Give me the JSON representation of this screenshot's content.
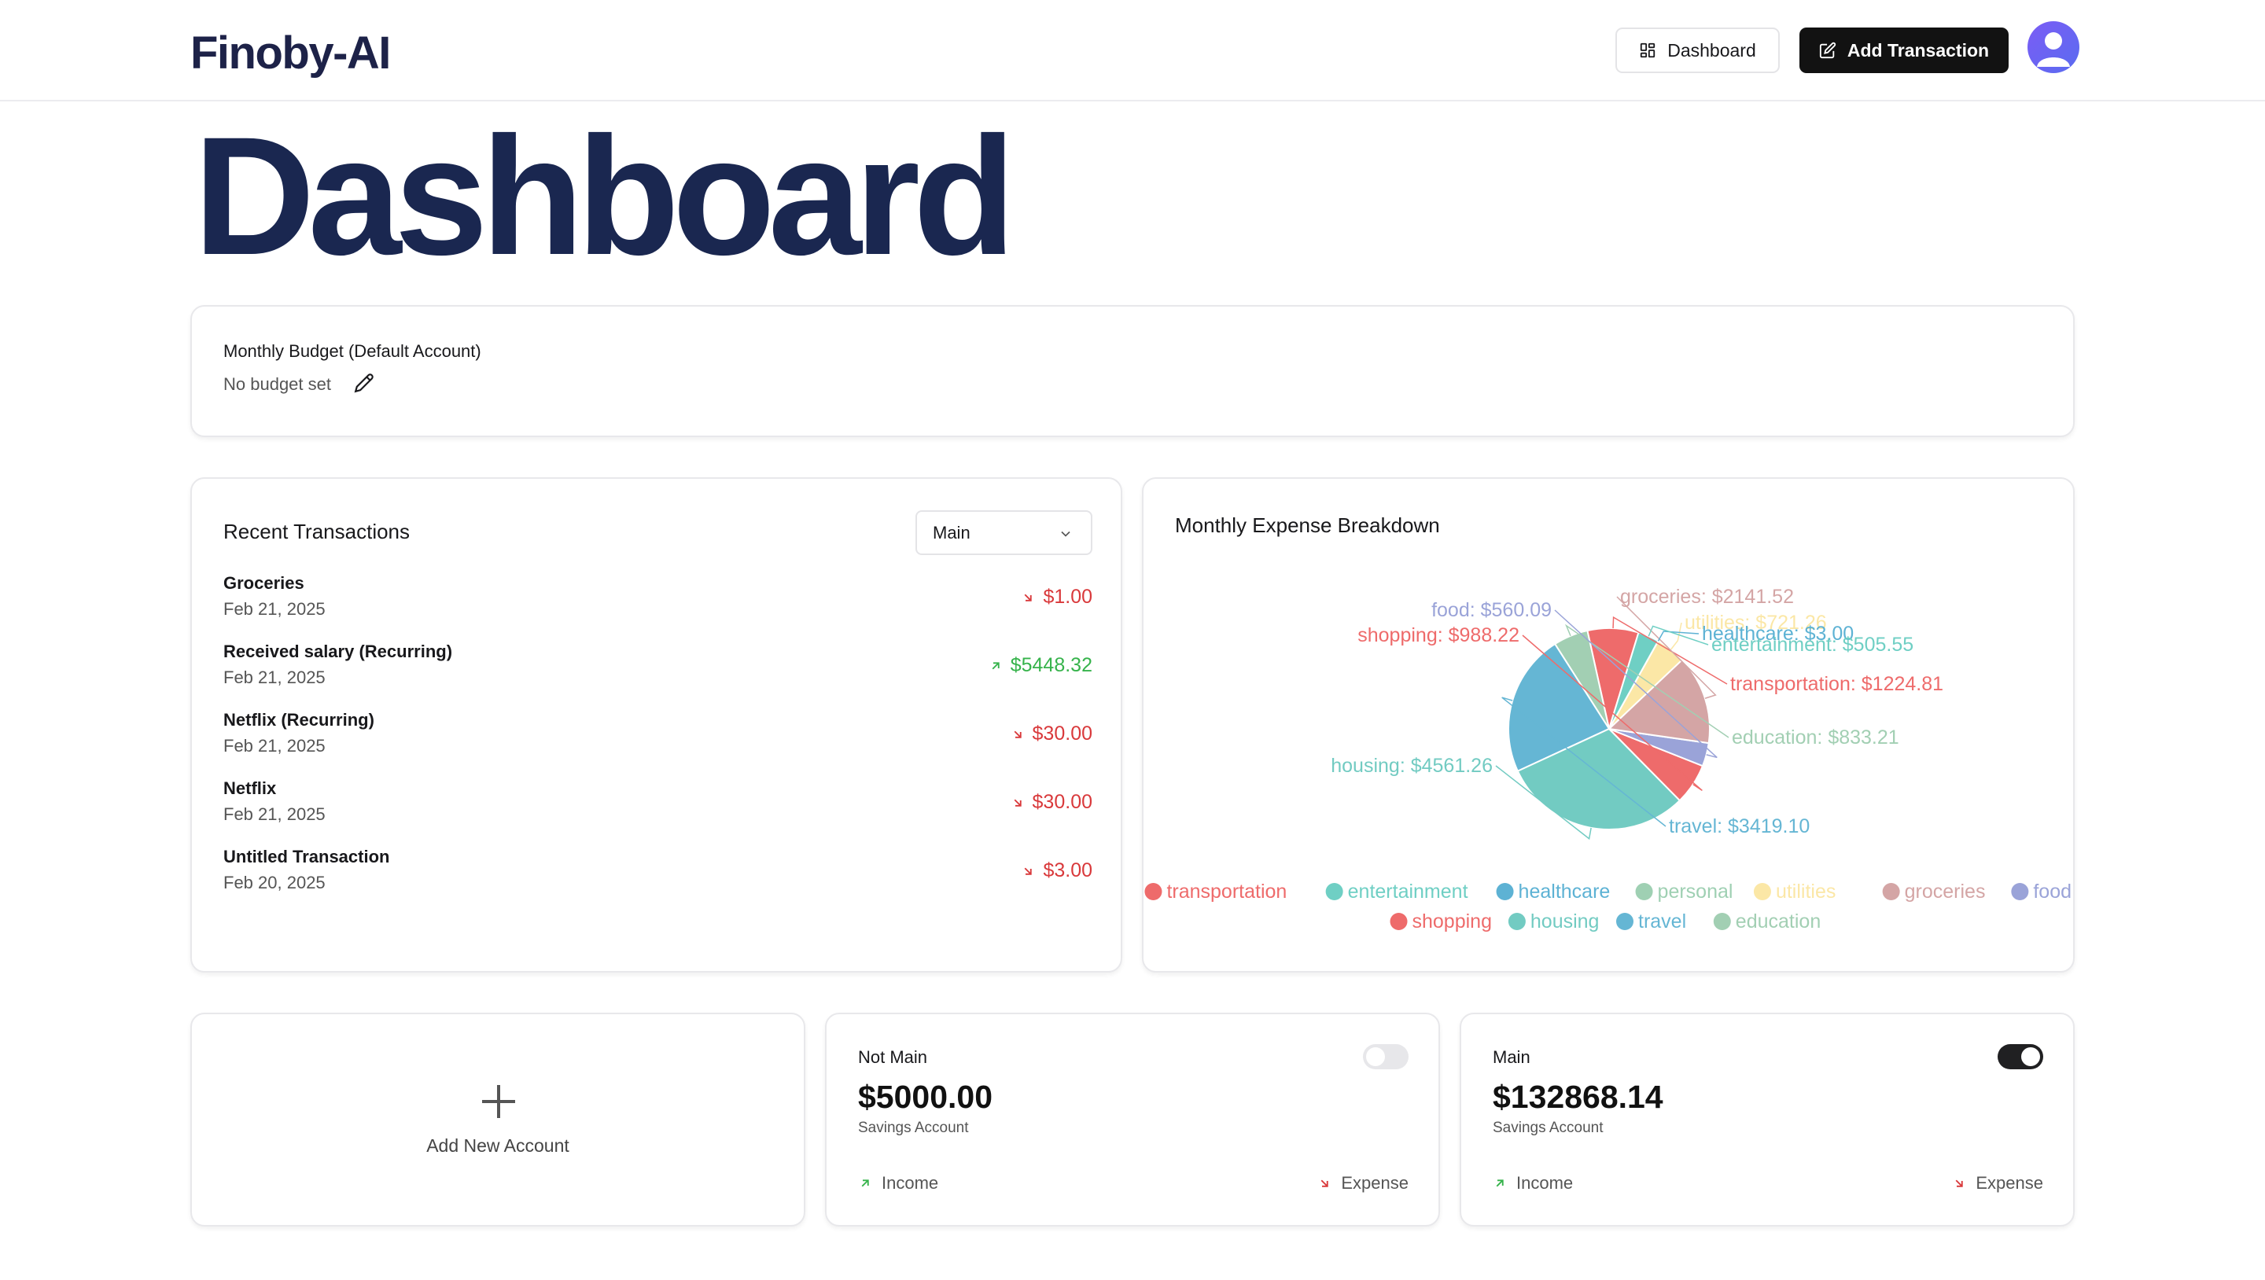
{
  "app": {
    "brand": "Finoby-AI"
  },
  "header": {
    "dashboard_label": "Dashboard",
    "add_transaction_label": "Add Transaction"
  },
  "page": {
    "title": "Dashboard"
  },
  "budget": {
    "title": "Monthly Budget (Default Account)",
    "status": "No budget set"
  },
  "recent": {
    "title": "Recent Transactions",
    "account_select": "Main",
    "items": [
      {
        "name": "Groceries",
        "date": "Feb 21, 2025",
        "amount": "$1.00",
        "direction": "expense"
      },
      {
        "name": "Received salary (Recurring)",
        "date": "Feb 21, 2025",
        "amount": "$5448.32",
        "direction": "income"
      },
      {
        "name": "Netflix (Recurring)",
        "date": "Feb 21, 2025",
        "amount": "$30.00",
        "direction": "expense"
      },
      {
        "name": "Netflix",
        "date": "Feb 21, 2025",
        "amount": "$30.00",
        "direction": "expense"
      },
      {
        "name": "Untitled Transaction",
        "date": "Feb 20, 2025",
        "amount": "$3.00",
        "direction": "expense"
      }
    ]
  },
  "expense": {
    "title": "Monthly Expense Breakdown"
  },
  "chart_data": {
    "type": "pie",
    "title": "Monthly Expense Breakdown",
    "legend_position": "bottom",
    "slices": [
      {
        "name": "transportation",
        "value": 1224.81,
        "label": "transportation: $1224.81",
        "color": "#ee6b6b"
      },
      {
        "name": "entertainment",
        "value": 505.55,
        "label": "entertainment: $505.55",
        "color": "#6fcfc4"
      },
      {
        "name": "healthcare",
        "value": 3.0,
        "label": "healthcare: $3.00",
        "color": "#5db2d4"
      },
      {
        "name": "personal",
        "value": 0,
        "label": "",
        "color": "#9fd0b3"
      },
      {
        "name": "utilities",
        "value": 721.26,
        "label": "utilities: $721.26",
        "color": "#fbe7a6"
      },
      {
        "name": "groceries",
        "value": 2141.52,
        "label": "groceries: $2141.52",
        "color": "#d4a5a5"
      },
      {
        "name": "food",
        "value": 560.09,
        "label": "food: $560.09",
        "color": "#9aa3d8"
      },
      {
        "name": "shopping",
        "value": 988.22,
        "label": "shopping: $988.22",
        "color": "#ee6b6b"
      },
      {
        "name": "housing",
        "value": 4561.26,
        "label": "housing: $4561.26",
        "color": "#72cbc2"
      },
      {
        "name": "travel",
        "value": 3419.1,
        "label": "travel: $3419.10",
        "color": "#65b6d4"
      },
      {
        "name": "education",
        "value": 833.21,
        "label": "education: $833.21",
        "color": "#a2cfb3"
      }
    ]
  },
  "accounts": {
    "add_label": "Add New Account",
    "list": [
      {
        "name": "Not Main",
        "balance": "$5000.00",
        "type": "Savings Account",
        "is_default": false,
        "income_label": "Income",
        "expense_label": "Expense"
      },
      {
        "name": "Main",
        "balance": "$132868.14",
        "type": "Savings Account",
        "is_default": true,
        "income_label": "Income",
        "expense_label": "Expense"
      }
    ]
  }
}
